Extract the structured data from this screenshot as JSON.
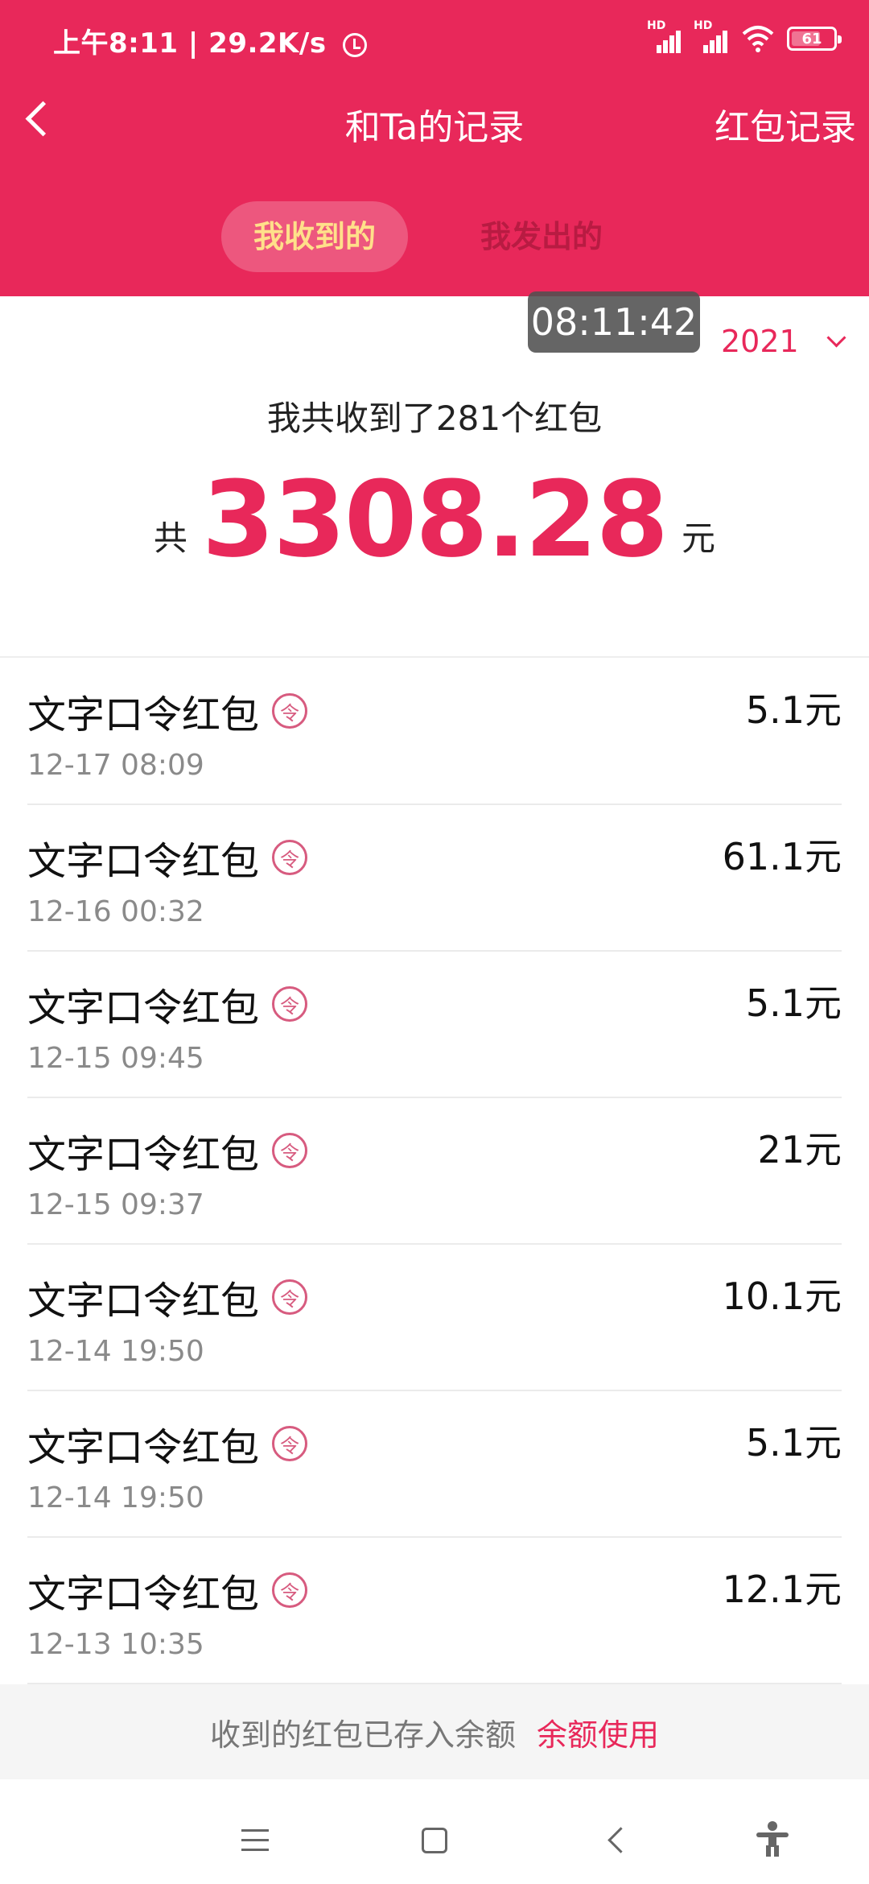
{
  "status_bar": {
    "time": "上午8:11",
    "speed": "29.2K/s",
    "hd1": "HD",
    "hd2": "HD",
    "battery": "61"
  },
  "header": {
    "title": "和Ta的记录",
    "right_link": "红包记录",
    "tabs": [
      {
        "label": "我收到的",
        "active": true
      },
      {
        "label": "我发出的",
        "active": false
      }
    ]
  },
  "overlay_time": "08:11:42",
  "year_selector": "2021",
  "summary": {
    "text": "我共收到了281个红包",
    "prefix": "共",
    "amount": "3308.28",
    "suffix": "元"
  },
  "records": [
    {
      "name": "文字口令红包",
      "badge": "令",
      "date": "12-17 08:09",
      "amount": "5.1元"
    },
    {
      "name": "文字口令红包",
      "badge": "令",
      "date": "12-16 00:32",
      "amount": "61.1元"
    },
    {
      "name": "文字口令红包",
      "badge": "令",
      "date": "12-15 09:45",
      "amount": "5.1元"
    },
    {
      "name": "文字口令红包",
      "badge": "令",
      "date": "12-15 09:37",
      "amount": "21元"
    },
    {
      "name": "文字口令红包",
      "badge": "令",
      "date": "12-14 19:50",
      "amount": "10.1元"
    },
    {
      "name": "文字口令红包",
      "badge": "令",
      "date": "12-14 19:50",
      "amount": "5.1元"
    },
    {
      "name": "文字口令红包",
      "badge": "令",
      "date": "12-13 10:35",
      "amount": "12.1元"
    }
  ],
  "footer": {
    "note": "收到的红包已存入余额",
    "link": "余额使用"
  },
  "colors": {
    "brand": "#e8285a",
    "tab_active_text": "#ffe08a"
  },
  "icons": [
    "back-arrow-icon",
    "alarm-icon",
    "signal-icon",
    "wifi-icon",
    "battery-icon",
    "chevron-down-icon",
    "command-badge-icon",
    "menu-icon",
    "home-icon",
    "nav-back-icon",
    "accessibility-icon"
  ]
}
